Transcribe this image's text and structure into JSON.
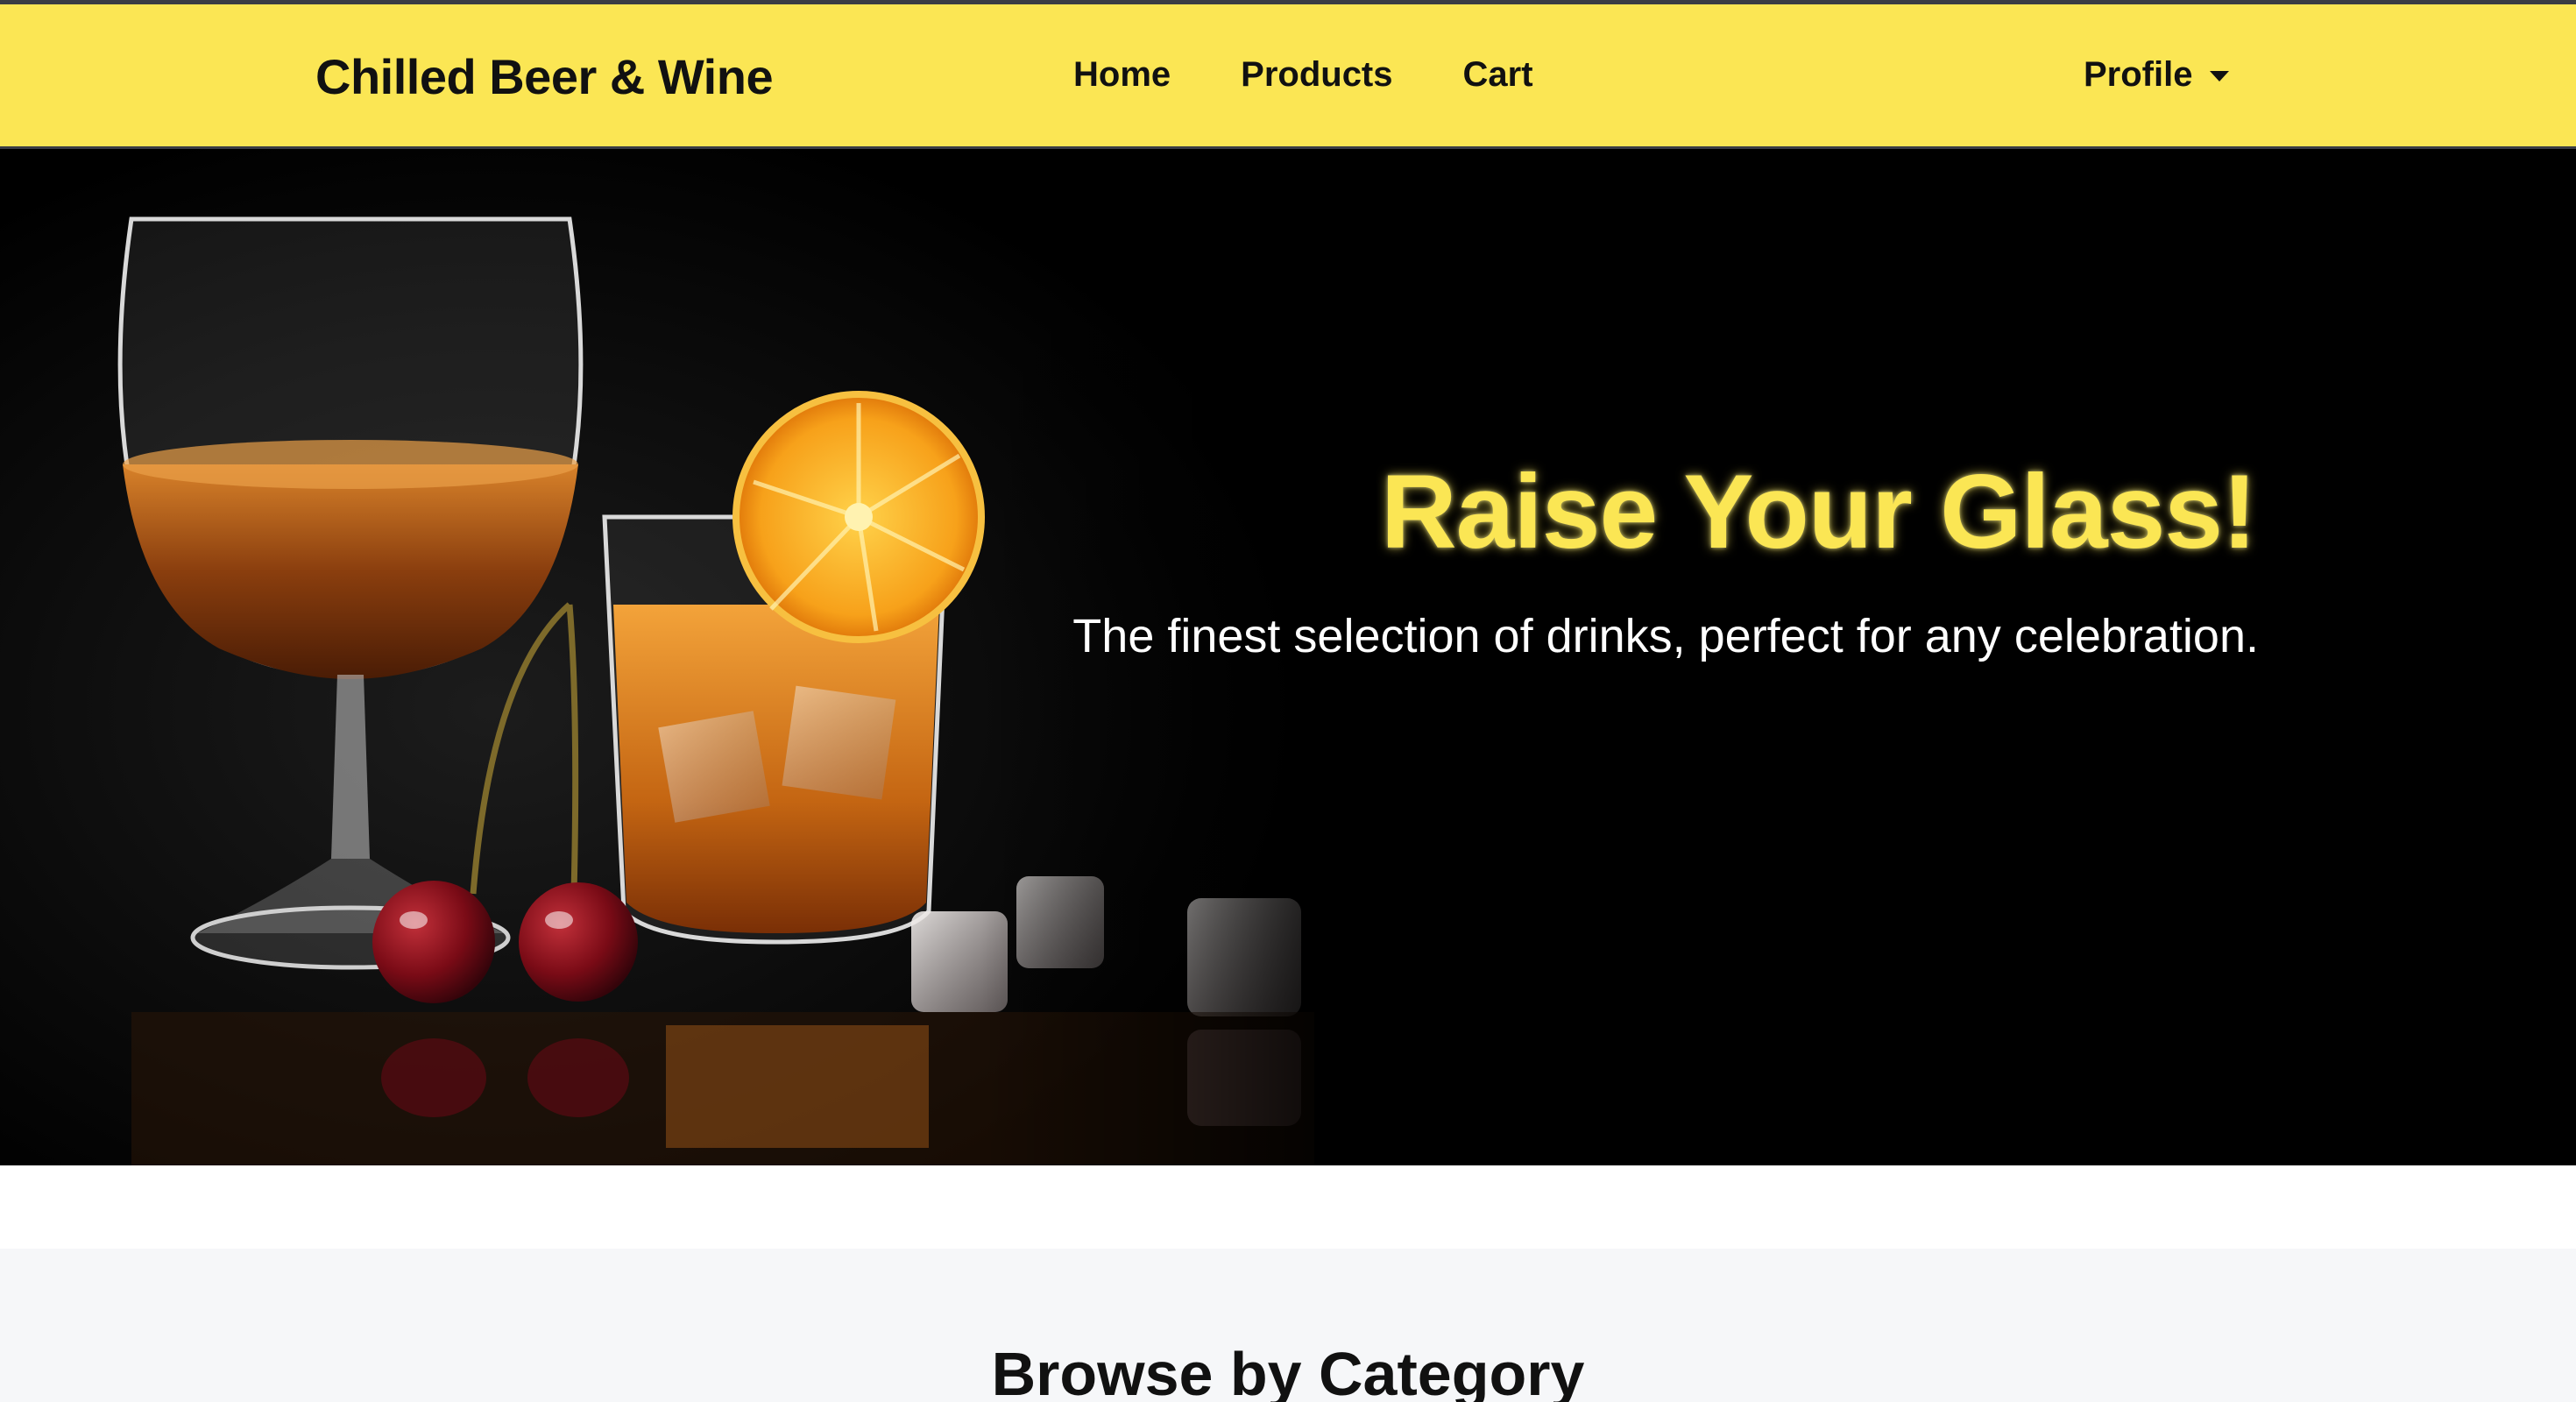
{
  "navbar": {
    "brand": "Chilled Beer & Wine",
    "links": [
      {
        "label": "Home"
      },
      {
        "label": "Products"
      },
      {
        "label": "Cart"
      }
    ],
    "profile_label": "Profile",
    "dropdown_icon": "caret-down-icon",
    "background_color": "#fbe654"
  },
  "hero": {
    "title": "Raise Your Glass!",
    "subtitle": "The finest selection of drinks, perfect for any celebration.",
    "title_color": "#fbe654",
    "image_subject": "snifter glass, whisky tumbler with orange slice, cherries and ice cubes"
  },
  "categories": {
    "heading": "Browse by Category"
  }
}
